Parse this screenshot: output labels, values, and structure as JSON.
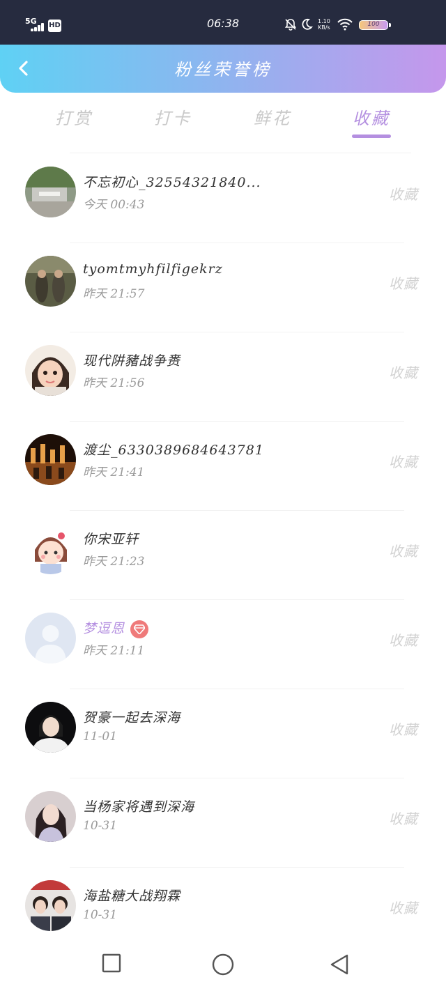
{
  "status_bar": {
    "network": "5G",
    "hd": "HD",
    "time": "06:38",
    "speed_top": "1.10",
    "speed_bottom": "KB/s",
    "battery": "100",
    "icons": [
      "bell-off-icon",
      "moon-icon",
      "wifi-icon"
    ]
  },
  "header": {
    "back_icon": "chevron-left-icon",
    "title": "粉丝荣誉榜"
  },
  "tabs": [
    {
      "label": "打赏",
      "active": false
    },
    {
      "label": "打卡",
      "active": false
    },
    {
      "label": "鲜花",
      "active": false
    },
    {
      "label": "收藏",
      "active": true
    }
  ],
  "entries": [
    {
      "name": "不忘初心_32554321840...",
      "time": "今天 00:43",
      "action": "收藏",
      "vip": false
    },
    {
      "name": "tyomtmyhfilfigekrz",
      "time": "昨天 21:57",
      "action": "收藏",
      "vip": false
    },
    {
      "name": "现代阱豬战争赉",
      "time": "昨天 21:56",
      "action": "收藏",
      "vip": false
    },
    {
      "name": "渡尘_6330389684643781",
      "time": "昨天 21:41",
      "action": "收藏",
      "vip": false
    },
    {
      "name": "你宋亚轩",
      "time": "昨天 21:23",
      "action": "收藏",
      "vip": false
    },
    {
      "name": "梦逗恩",
      "time": "昨天 21:11",
      "action": "收藏",
      "vip": true
    },
    {
      "name": "贺豪一起去深海",
      "time": "11-01",
      "action": "收藏",
      "vip": false
    },
    {
      "name": "当杨家将遇到深海",
      "time": "10-31",
      "action": "收藏",
      "vip": false
    },
    {
      "name": "海盐糖大战翔霖",
      "time": "10-31",
      "action": "收藏",
      "vip": false
    }
  ],
  "nav_bar": {
    "icons": [
      "square-recents-icon",
      "circle-home-icon",
      "triangle-back-icon"
    ]
  },
  "colors": {
    "accent": "#b48fe0",
    "header_gradient_start": "#5fd1f4",
    "header_gradient_end": "#c597ec",
    "status_bar": "#262b3f"
  }
}
